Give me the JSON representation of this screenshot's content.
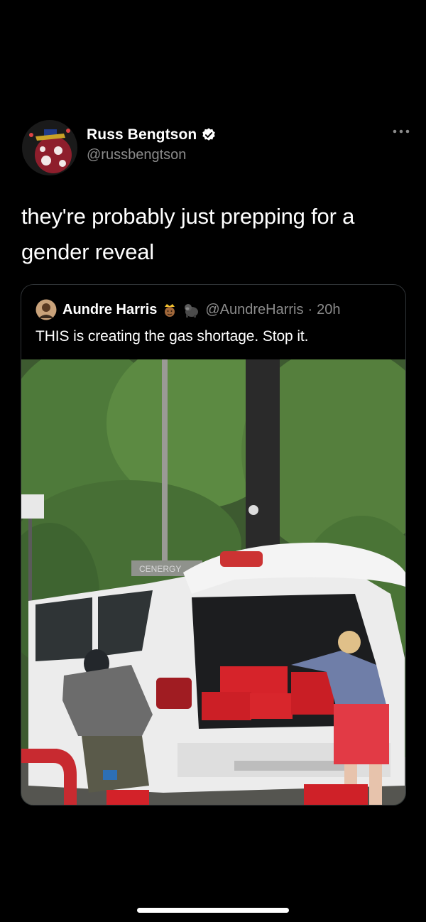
{
  "author": {
    "name": "Russ Bengtson",
    "handle": "@russbengtson",
    "verified": true
  },
  "tweet": {
    "text_line1": "they're probably just prepping for a",
    "text_line2": "gender reveal"
  },
  "quoted": {
    "name": "Aundre Harris",
    "emojis": [
      "crown-face-emoji",
      "gorilla-emoji"
    ],
    "handle": "@AundreHarris",
    "separator": "·",
    "time": "20h",
    "text": "THIS is creating the gas shortage. Stop it.",
    "media": {
      "sign_text": "CENERGY"
    }
  },
  "colors": {
    "background": "#000000",
    "text": "#ffffff",
    "secondary_text": "#8b8b8b",
    "border": "#2f3336"
  }
}
